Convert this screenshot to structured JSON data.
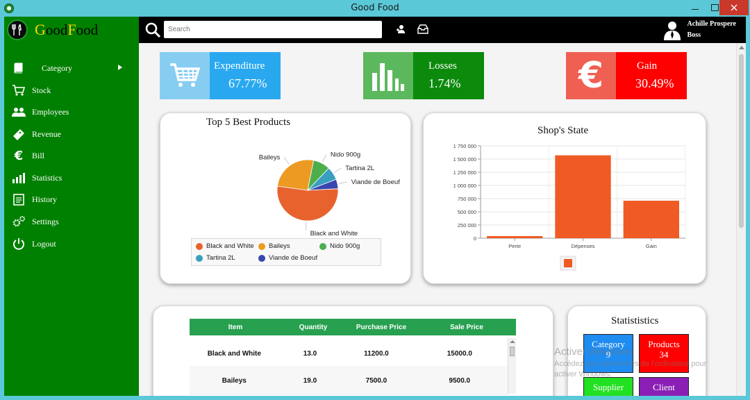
{
  "window": {
    "title": "Good Food"
  },
  "brand": {
    "name_first_cap": "G",
    "name_first_rest": "ood",
    "name_second_cap": "F",
    "name_second_rest": "ood"
  },
  "search": {
    "placeholder": "Search"
  },
  "user": {
    "name": "Achille Prospere",
    "role": "Boss"
  },
  "sidebar": {
    "items": [
      {
        "label": "Category",
        "icon": "book-icon"
      },
      {
        "label": "Stock",
        "icon": "cart-icon"
      },
      {
        "label": "Employees",
        "icon": "people-icon"
      },
      {
        "label": "Revenue",
        "icon": "ticket-icon"
      },
      {
        "label": "Bill",
        "icon": "euro-icon"
      },
      {
        "label": "Statistics",
        "icon": "chart-icon"
      },
      {
        "label": "History",
        "icon": "clipboard-icon"
      },
      {
        "label": "Settings",
        "icon": "gears-icon"
      },
      {
        "label": "Logout",
        "icon": "power-icon"
      }
    ]
  },
  "kpis": [
    {
      "title": "Expenditure",
      "value": "67.77%",
      "icon": "cart-icon",
      "icon_bg": "#87cdf2",
      "body_bg": "#29a8f0"
    },
    {
      "title": "Losses",
      "value": "1.74%",
      "icon": "bar-chart-icon",
      "icon_bg": "#5cb85c",
      "body_bg": "#0c8a0c"
    },
    {
      "title": "Gain",
      "value": "30.49%",
      "icon": "euro-icon",
      "icon_bg": "#ef5f52",
      "body_bg": "#ff0000"
    }
  ],
  "pie_card": {
    "title": "Top 5 Best Products",
    "chart_data": {
      "type": "pie",
      "slices": [
        {
          "label": "Black and White",
          "value": 53,
          "color": "#e8622e"
        },
        {
          "label": "Baileys",
          "value": 26,
          "color": "#ec9a22"
        },
        {
          "label": "Nido 900g",
          "value": 9,
          "color": "#4cae4c"
        },
        {
          "label": "Tartina 2L",
          "value": 7,
          "color": "#3a9ebf"
        },
        {
          "label": "Viande de Boeuf",
          "value": 5,
          "color": "#3a46b0"
        }
      ]
    }
  },
  "bar_card": {
    "title": "Shop's State",
    "chart_data": {
      "type": "bar",
      "categories": [
        "Perte",
        "Dépenses",
        "Gain"
      ],
      "values": [
        40000,
        1570000,
        710000
      ],
      "ylim": [
        0,
        1750000
      ],
      "yticks": [
        "0",
        "250 000",
        "500 000",
        "750 000",
        "1 000 000",
        "1 250 000",
        "1 500 000",
        "1 750 000"
      ],
      "color": "#f05a24",
      "grid": true
    }
  },
  "table": {
    "headers": [
      "Item",
      "Quantity",
      "Purchase Price",
      "Sale Price"
    ],
    "rows": [
      [
        "Black and White",
        "13.0",
        "11200.0",
        "15000.0"
      ],
      [
        "Baileys",
        "19.0",
        "7500.0",
        "9500.0"
      ]
    ]
  },
  "stats": {
    "title": "Statististics",
    "tiles": [
      {
        "label": "Category",
        "value": "9",
        "color": "#1e8cf0"
      },
      {
        "label": "Products",
        "value": "34",
        "color": "#ff0000"
      },
      {
        "label": "Supplier",
        "value": "",
        "color": "#22e022"
      },
      {
        "label": "Client",
        "value": "",
        "color": "#8a1fb5"
      }
    ]
  },
  "watermark": {
    "line1": "Activer Windows",
    "line2": "Accédez aux paramètres de l'ordinateur pour activer Windows."
  }
}
